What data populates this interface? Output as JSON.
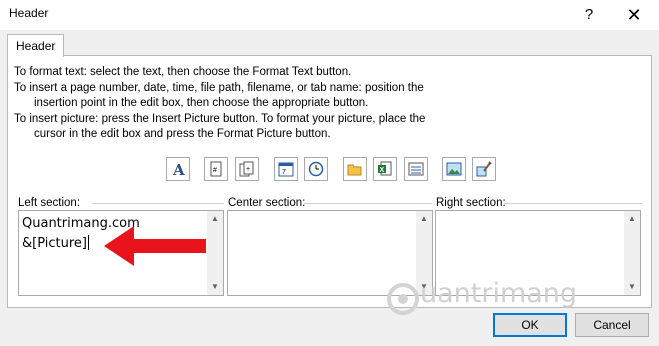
{
  "window": {
    "title": "Header",
    "help_glyph": "?",
    "close_glyph": "✕"
  },
  "tabs": [
    {
      "label": "Header"
    }
  ],
  "instructions": [
    "To format text:  select the text, then choose the Format Text button.",
    "To insert a page number, date, time, file path, filename, or tab name:  position the",
    "insertion point in the edit box, then choose the appropriate button.",
    "To insert picture: press the Insert Picture button.  To format your picture, place the",
    "cursor in the edit box and press the Format Picture button."
  ],
  "toolbar": {
    "buttons": [
      {
        "icon": "format-text-icon"
      },
      {
        "icon": "page-number-icon"
      },
      {
        "icon": "number-of-pages-icon"
      },
      {
        "icon": "date-icon"
      },
      {
        "icon": "time-icon"
      },
      {
        "icon": "file-path-icon"
      },
      {
        "icon": "file-name-icon"
      },
      {
        "icon": "sheet-name-icon"
      },
      {
        "icon": "insert-picture-icon"
      },
      {
        "icon": "format-picture-icon"
      }
    ]
  },
  "sections": {
    "left": {
      "label": "Left section:",
      "lines": [
        "Quantrimang.com",
        "&[Picture]"
      ]
    },
    "center": {
      "label": "Center section:"
    },
    "right": {
      "label": "Right section:"
    }
  },
  "buttons": {
    "ok": "OK",
    "cancel": "Cancel"
  },
  "watermark": "uantrimang",
  "colors": {
    "arrow": "#e8131b",
    "default_button_border": "#0078d7"
  }
}
